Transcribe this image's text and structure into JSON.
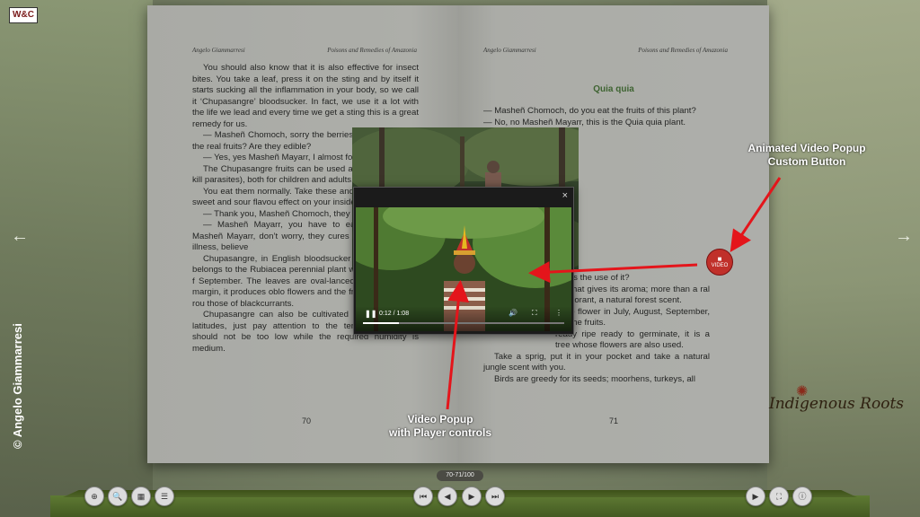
{
  "logo_text": "W&C",
  "copyright": "© Angelo Giammarresi",
  "nav": {
    "prev": "←",
    "next": "→"
  },
  "left_page": {
    "author": "Angelo Giammarresi",
    "book_title": "Poisons and Remedies of Amazonia",
    "number": "70",
    "paragraphs": [
      "You should also know that it is also effective for insect bites. You take a leaf, press it on the sting and by itself it starts sucking all the inflammation in your body, so we call it ‘Chupasangre’ bloodsucker. In fact, we use it a lot with the life we lead and every time we get a sting this is a great remedy for us.",
      "— Masheñ Chomoch, sorry the berries you can see are the real fruits? Are they edible?",
      "— Yes, yes Masheñ Mayarr, I almost forgot to tell you.",
      "The Chupasangre fruits can be used as a vermifuge (to kill parasites), both for children and adults.",
      "You eat them normally. Take these and have a pleasant sweet and sour flavou effect on your insides.",
      "— Thank you, Masheñ Chomoch, they",
      "— Masheñ Mayarr, you have to eat six the most.  Masheñ Mayarr, don’t worry, they cures you of any other illness, believe",
      "Chupasangre, in English bloodsucker Hamelia patens, belongs to the Rubiacea perennial plant with flowering and f September. The leaves are oval-lanceola rib and entire margin, it produces oblo flowers and the fruits are dark and rou those of blackcurrants.",
      "Chupasangre can also be cultivated in our European latitudes, just pay attention to the temperature which should not be too low while the required humidity is medium."
    ]
  },
  "right_page": {
    "author": "Angelo Giammarresi",
    "book_title": "Poisons and Remedies of Amazonia",
    "number": "71",
    "section_title": "Quia quia",
    "intro_lines": [
      "— Masheñ Chomoch, do you eat the fruits of this plant?",
      "— No, no Masheñ Mayarr, this is the Quia quia plant."
    ],
    "paragraphs_after_photo": [
      "is the use of it?",
      "ant that gives its aroma; more than a ral deodorant, a natural forest scent.",
      "ns to flower in July, August, September, are the fruits.",
      "ready ripe ready to germinate, it is a tree whose flowers are also used.",
      "Take a sprig, put it in your pocket and take a natural jungle scent with you.",
      "Birds are greedy for its seeds; moorhens, turkeys, all"
    ]
  },
  "video_button_label": "VIDEO",
  "popup": {
    "close": "×",
    "play_icon": "❚❚",
    "time": "0:12 / 1:08",
    "progress": 0.18,
    "volume_icon": "🔊",
    "fullscreen_icon": "⛶",
    "menu_icon": "⋮"
  },
  "annotations": {
    "custom_button": "Animated Video Popup\nCustom Button",
    "player": "Video Popup\nwith Player controls"
  },
  "brand": "Indigenous Roots",
  "brand_icon": "sun-icon",
  "page_counter": "70-71/100",
  "toolbar": {
    "zoom_in": "⊕",
    "search": "🔍",
    "thumbnails": "▦",
    "toc": "☰",
    "first": "⏮",
    "prev": "◀",
    "next": "▶",
    "last": "⏭",
    "autoplay": "▶",
    "fullscreen": "⛶",
    "info": "ⓘ"
  },
  "colors": {
    "accent_red": "#c0302a",
    "section_green": "#3f7a2a",
    "shelf_green": "#4f6628"
  }
}
